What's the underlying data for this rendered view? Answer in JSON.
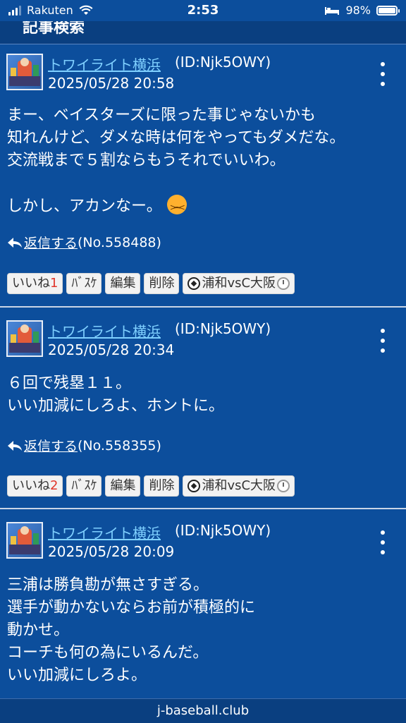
{
  "status_bar": {
    "carrier": "Rakuten",
    "time": "2:53",
    "battery": "98%",
    "battery_level": 0.98
  },
  "header": {
    "title": "記事検索"
  },
  "posts": [
    {
      "user": "トワイライト横浜",
      "user_id": "(ID:Njk5OWY)",
      "date": "2025/05/28 20:58",
      "body_lines": [
        "まー、ベイスターズに限った事じゃないかも",
        "知れんけど、ダメな時は何をやってもダメだな。",
        "交流戦まで５割ならもうそれでいいわ。",
        "",
        "しかし、アカンなー。"
      ],
      "reply_label": "返信する",
      "reply_no": "(No.558488)",
      "like_label": "いいね",
      "like_count": "1",
      "basket_label": "ﾊﾞｽｹ",
      "edit_label": "編集",
      "delete_label": "削除",
      "match_label": "浦和vsC大阪"
    },
    {
      "user": "トワイライト横浜",
      "user_id": "(ID:Njk5OWY)",
      "date": "2025/05/28 20:34",
      "body_lines": [
        "６回で残塁１１。",
        "いい加減にしろよ、ホントに。"
      ],
      "reply_label": "返信する",
      "reply_no": "(No.558355)",
      "like_label": "いいね",
      "like_count": "2",
      "basket_label": "ﾊﾞｽｹ",
      "edit_label": "編集",
      "delete_label": "削除",
      "match_label": "浦和vsC大阪"
    },
    {
      "user": "トワイライト横浜",
      "user_id": "(ID:Njk5OWY)",
      "date": "2025/05/28 20:09",
      "body_lines": [
        "三浦は勝負勘が無さすぎる。",
        "選手が動かないならお前が積極的に",
        "動かせ。",
        "コーチも何の為にいるんだ。",
        "いい加減にしろよ。"
      ]
    }
  ],
  "footer": {
    "site": "j-baseball.club"
  }
}
